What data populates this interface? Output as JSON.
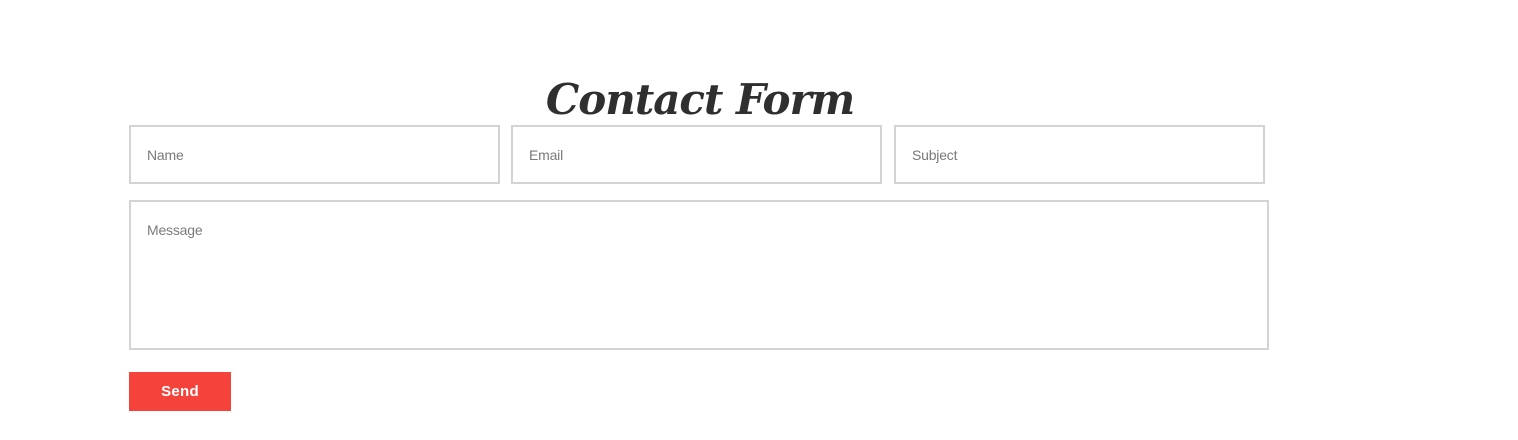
{
  "form": {
    "title": "Contact Form",
    "name": {
      "value": "",
      "placeholder": "Name"
    },
    "email": {
      "value": "",
      "placeholder": "Email"
    },
    "subject": {
      "value": "",
      "placeholder": "Subject"
    },
    "message": {
      "value": "",
      "placeholder": "Message"
    },
    "send_label": "Send"
  },
  "colors": {
    "accent": "#f5433b",
    "title": "#2f2f2f",
    "field_border": "#d3d3d3",
    "placeholder": "#7a7a7a",
    "background": "#ffffff"
  }
}
